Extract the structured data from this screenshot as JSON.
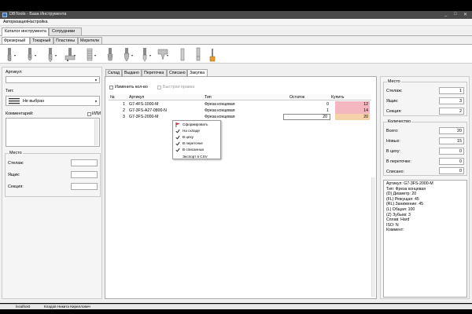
{
  "window": {
    "title": "DBTools - База Инструмента",
    "controls": [
      "_",
      "□",
      "✕"
    ]
  },
  "menu": [
    "Авторизация",
    "Настройка"
  ],
  "main_tabs": [
    "Каталог инструмента",
    "Сотрудники"
  ],
  "sub_tabs": [
    "Фрезерный",
    "Токарный",
    "Пластины",
    "Мерители"
  ],
  "toolbar_icons": [
    "end-mill-icon",
    "ball-mill-icon",
    "drill-icon",
    "boring-bar-icon",
    "tap-holder-icon",
    "thread-mill-icon",
    "face-mill-icon",
    "chamfer-icon",
    "shell-mill-icon",
    "reamer-icon",
    "collet-icon",
    "center-drill-icon"
  ],
  "left": {
    "article_label": "Артикул:",
    "article_value": "",
    "type_label": "Тип:",
    "type_value": "Не выбран",
    "comment_label": "Комментарий:",
    "or_label": "ИЛИ",
    "place_group": "Место",
    "rack_label": "Стелаж:",
    "box_label": "Ящик:",
    "section_label": "Секция:"
  },
  "center": {
    "tabs": [
      "Склад",
      "Выдано",
      "Переточка",
      "Списано",
      "Закупка"
    ],
    "active_tab": 4,
    "edit_qty_label": "Изменить кол-во",
    "quick_edit_label": "Быстрая правка",
    "columns": [
      "№",
      "Артикул",
      "Тип",
      "Остаток",
      "Купить"
    ],
    "rows": [
      {
        "n": "1",
        "article": "G7-4FS-1000-M",
        "type": "Фреза концевая",
        "stock": "0",
        "buy": "12",
        "buy_color": "#f4b6bf"
      },
      {
        "n": "2",
        "article": "G7-3FS-A27-0800-N",
        "type": "Фреза концевая",
        "stock": "1",
        "buy": "14",
        "buy_color": "#f4b6bf"
      },
      {
        "n": "3",
        "article": "G7-3FS-2000-M",
        "type": "Фреза концевая",
        "stock": "20",
        "buy": "20",
        "buy_color": "#f5d2a8"
      }
    ]
  },
  "context_menu": {
    "items": [
      {
        "label": "Сформировать",
        "icon": "flag-icon"
      },
      {
        "label": "На складе",
        "icon": "check-icon"
      },
      {
        "label": "В цеху",
        "icon": "check-icon"
      },
      {
        "label": "В переточке",
        "icon": "check-icon"
      },
      {
        "label": "В списанных",
        "icon": "check-icon"
      },
      {
        "label": "Экспорт в CSV",
        "icon": ""
      }
    ]
  },
  "right": {
    "place_group": "Место",
    "rack_label": "Стелаж:",
    "rack_value": "1",
    "box_label": "Ящик:",
    "box_value": "3",
    "section_label": "Секция:",
    "section_value": "2",
    "qty_group": "Количество",
    "total_label": "Всего:",
    "total_value": "20",
    "new_label": "Новых:",
    "new_value": "15",
    "shop_label": "В цеху:",
    "shop_value": "0",
    "regrind_label": "В переточке:",
    "regrind_value": "0",
    "written_label": "Списано:",
    "written_value": "0",
    "info": [
      "Артикул: G7-3FS-2000-M",
      "Тип: Фреза концевая",
      "(D) Диаметр: 20",
      "(FL) Режущая: 45",
      "(RL) Занижение: 45",
      "(L) Общая: 100",
      "(Z) Зубьев: 3",
      "Сплав: Hard",
      "ISO: N",
      "Коммент:"
    ]
  },
  "status": {
    "host": "localhost",
    "user": "Кладов Никита Кириллович"
  },
  "colors": {
    "buy_red": "#f4b6bf",
    "buy_orange": "#f5d2a8",
    "flag": "#d9253a"
  }
}
